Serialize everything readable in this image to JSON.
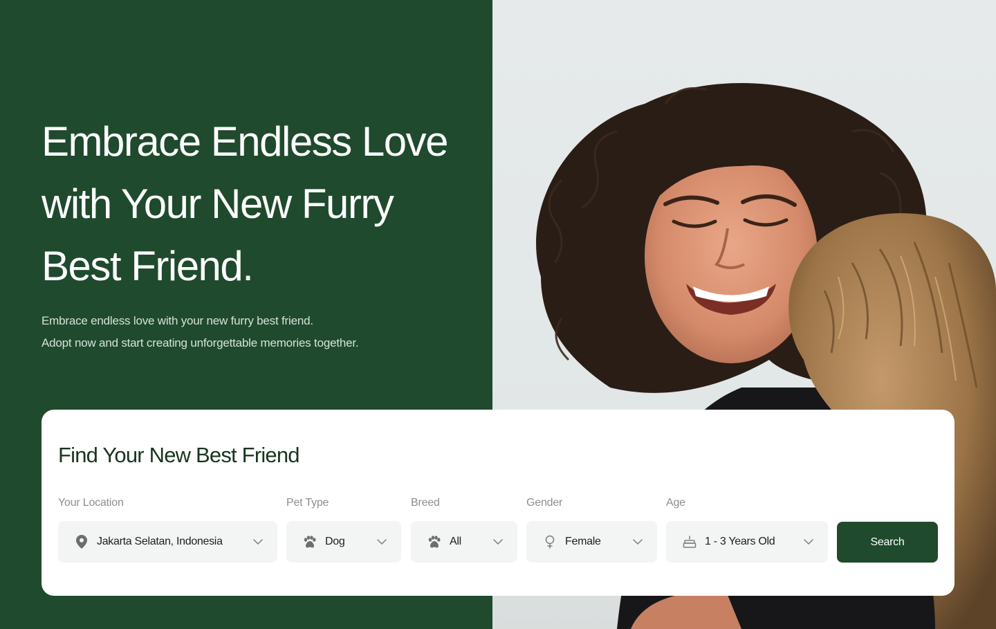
{
  "hero": {
    "title_line1": "Embrace Endless Love",
    "title_line2": "with Your New Furry",
    "title_line3": "Best Friend.",
    "subtitle_line1": "Embrace endless love with your new furry best friend.",
    "subtitle_line2": "Adopt now and start creating unforgettable memories together."
  },
  "search": {
    "title": "Find Your New Best Friend",
    "location": {
      "label": "Your Location",
      "value": "Jakarta Selatan, Indonesia",
      "icon": "location-pin-icon"
    },
    "pet_type": {
      "label": "Pet Type",
      "value": "Dog",
      "icon": "paw-icon"
    },
    "breed": {
      "label": "Breed",
      "value": "All",
      "icon": "paw-icon"
    },
    "gender": {
      "label": "Gender",
      "value": "Female",
      "icon": "female-icon"
    },
    "age": {
      "label": "Age",
      "value": "1 - 3 Years Old",
      "icon": "cake-icon"
    },
    "button_label": "Search"
  },
  "colors": {
    "brand_green": "#1f4a2d",
    "card_bg": "#ffffff",
    "field_bg": "#f3f4f4"
  }
}
